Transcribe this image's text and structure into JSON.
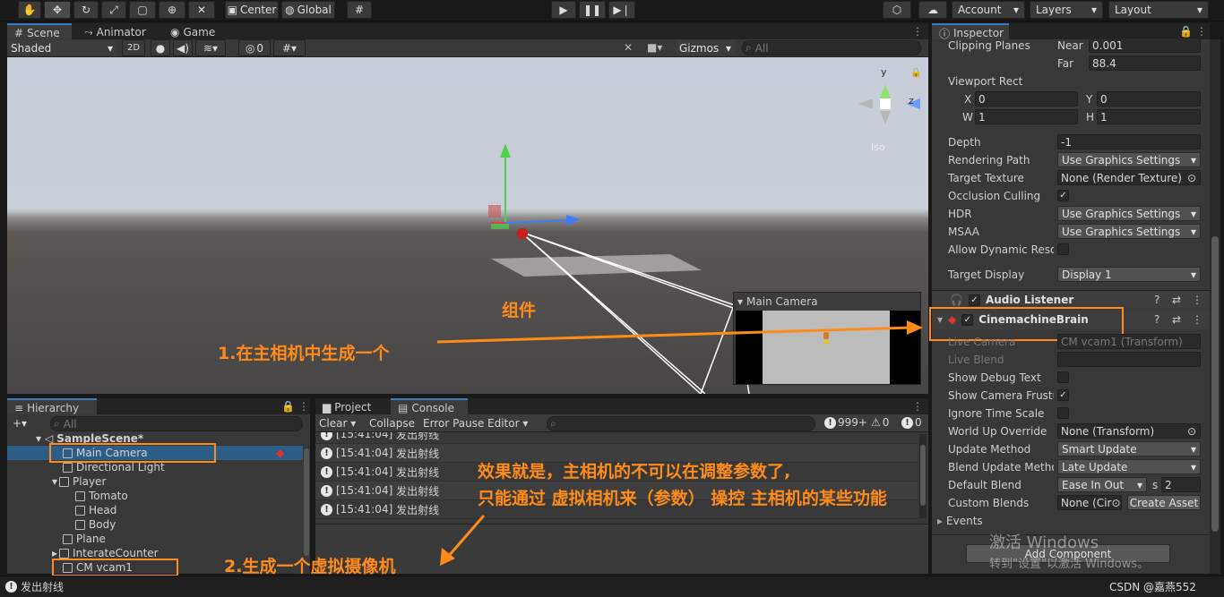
{
  "toolbar": {
    "center": "Center",
    "global": "Global",
    "account": "Account",
    "layers": "Layers",
    "layout": "Layout"
  },
  "scene_tabs": [
    {
      "label": "Scene"
    },
    {
      "label": "Animator"
    },
    {
      "label": "Game"
    }
  ],
  "scene_bar": {
    "shading": "Shaded",
    "mode2d": "2D",
    "fx_count": "0",
    "gizmos": "Gizmos",
    "search_placeholder": "All",
    "iso": "Iso",
    "axis_y": "y",
    "axis_z": "z"
  },
  "camera_preview": {
    "title": "Main Camera"
  },
  "annotations": {
    "component": "组件",
    "step1": "1.在主相机中生成一个",
    "effect_line1": "效果就是，主相机的不可以在调整参数了,",
    "effect_line2": "只能通过  虚拟相机来（参数） 操控  主相机的某些功能",
    "step2": "2.生成一个虚拟摄像机",
    "accent": "#ff8c1a"
  },
  "hierarchy": {
    "title": "Hierarchy",
    "search_placeholder": "All",
    "scene": "SampleScene*",
    "items": [
      {
        "label": "Main Camera"
      },
      {
        "label": "Directional Light"
      },
      {
        "label": "Player"
      },
      {
        "label": "Tomato"
      },
      {
        "label": "Head"
      },
      {
        "label": "Body"
      },
      {
        "label": "Plane"
      },
      {
        "label": "InterateCounter"
      },
      {
        "label": "CM vcam1"
      }
    ]
  },
  "console": {
    "tab_project": "Project",
    "tab_console": "Console",
    "clear": "Clear",
    "collapse": "Collapse",
    "error_pause": "Error Pause",
    "editor": "Editor",
    "count_info": "999+",
    "count_warn": "0",
    "count_error": "0",
    "messages": [
      {
        "time": "[15:41:04]",
        "text": "发出射线"
      },
      {
        "time": "[15:41:04]",
        "text": "发出射线"
      },
      {
        "time": "[15:41:04]",
        "text": "发出射线"
      },
      {
        "time": "[15:41:04]",
        "text": "发出射线"
      },
      {
        "time": "[15:41:04]",
        "text": "发出射线"
      }
    ]
  },
  "inspector": {
    "title": "Inspector",
    "clipping_planes": "Clipping Planes",
    "near_label": "Near",
    "near": "0.001",
    "far_label": "Far",
    "far": "88.4",
    "viewport_rect": "Viewport Rect",
    "x_label": "X",
    "x": "0",
    "y_label": "Y",
    "y": "0",
    "w_label": "W",
    "w": "1",
    "h_label": "H",
    "h": "1",
    "depth_label": "Depth",
    "depth": "-1",
    "rendering_path_label": "Rendering Path",
    "rendering_path": "Use Graphics Settings",
    "target_texture_label": "Target Texture",
    "target_texture": "None (Render Texture)",
    "occlusion_label": "Occlusion Culling",
    "hdr_label": "HDR",
    "hdr": "Use Graphics Settings",
    "msaa_label": "MSAA",
    "msaa": "Use Graphics Settings",
    "dynamic_res_label": "Allow Dynamic Resol",
    "target_display_label": "Target Display",
    "target_display": "Display 1",
    "audio_listener": "Audio Listener",
    "brain": "CinemachineBrain",
    "live_camera_label": "Live Camera",
    "live_camera": "CM vcam1 (Transform)",
    "live_blend_label": "Live Blend",
    "show_debug_label": "Show Debug Text",
    "show_frustum_label": "Show Camera Frustur",
    "ignore_time_label": "Ignore Time Scale",
    "world_up_label": "World Up Override",
    "world_up": "None (Transform)",
    "update_method_label": "Update Method",
    "update_method": "Smart Update",
    "blend_update_label": "Blend Update Methoc",
    "blend_update": "Late Update",
    "default_blend_label": "Default Blend",
    "default_blend": "Ease In Out",
    "blend_s": "s",
    "blend_time": "2",
    "custom_blends_label": "Custom Blends",
    "custom_blends": "None (Cir",
    "create_asset": "Create Asset",
    "events": "Events",
    "add_component": "Add Component"
  },
  "watermark": {
    "line1": "激活 Windows",
    "line2": "转到\"设置\"以激活 Windows。"
  },
  "status": {
    "message": "发出射线",
    "credit": "CSDN @嘉燕552"
  }
}
